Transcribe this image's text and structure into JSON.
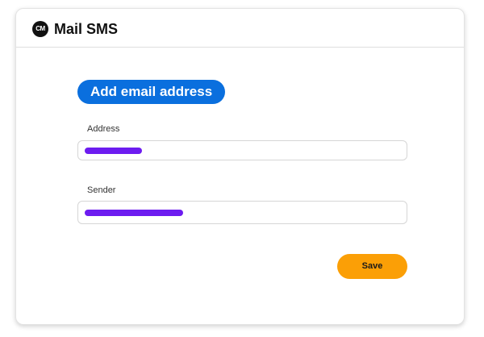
{
  "header": {
    "logo_text": "CM",
    "title": "Mail SMS"
  },
  "form": {
    "heading": "Add email address",
    "fields": [
      {
        "label": "Address",
        "value_redacted": true
      },
      {
        "label": "Sender",
        "value_redacted": true
      }
    ],
    "save_label": "Save"
  },
  "colors": {
    "accent_blue": "#0a6fde",
    "redaction_purple": "#6d1cf0",
    "save_orange": "#fb9f06"
  }
}
